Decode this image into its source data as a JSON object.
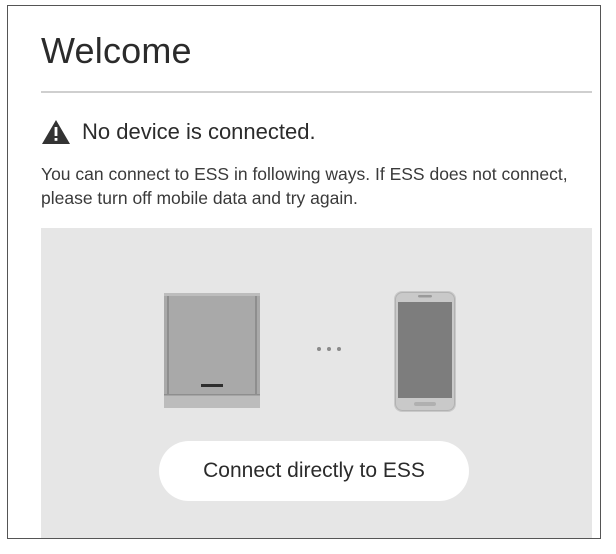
{
  "header": {
    "title": "Welcome"
  },
  "status": {
    "icon": "warning-icon",
    "message": "No device is connected."
  },
  "instructions": {
    "text": "You can connect to ESS in following ways. If ESS does not connect, please turn off mobile data and try again."
  },
  "connection_panel": {
    "illustration": [
      "ess-device-icon",
      "ellipsis-icon",
      "smartphone-icon"
    ],
    "connect_button_label": "Connect directly to ESS"
  },
  "colors": {
    "panel_background": "#e6e6e6",
    "text_primary": "#2b2b2b",
    "button_background": "#ffffff"
  }
}
